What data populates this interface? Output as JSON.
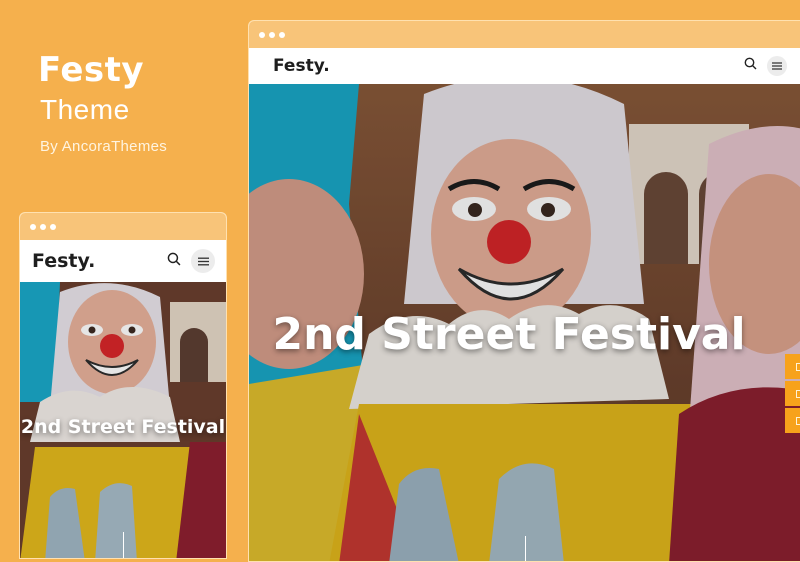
{
  "promo": {
    "title": "Festy",
    "subtitle": "Theme",
    "author": "By AncoraThemes"
  },
  "desktop": {
    "logo": "Festy.",
    "hero_title": "2nd Street Festival"
  },
  "mobile": {
    "logo": "Festy.",
    "hero_title": "2nd Street Festival"
  },
  "colors": {
    "background": "#f5b04d",
    "browser_bar": "#f8c479",
    "accent_tab": "#f7a21b"
  },
  "icons": [
    "search-icon",
    "menu-icon",
    "window-dots"
  ]
}
